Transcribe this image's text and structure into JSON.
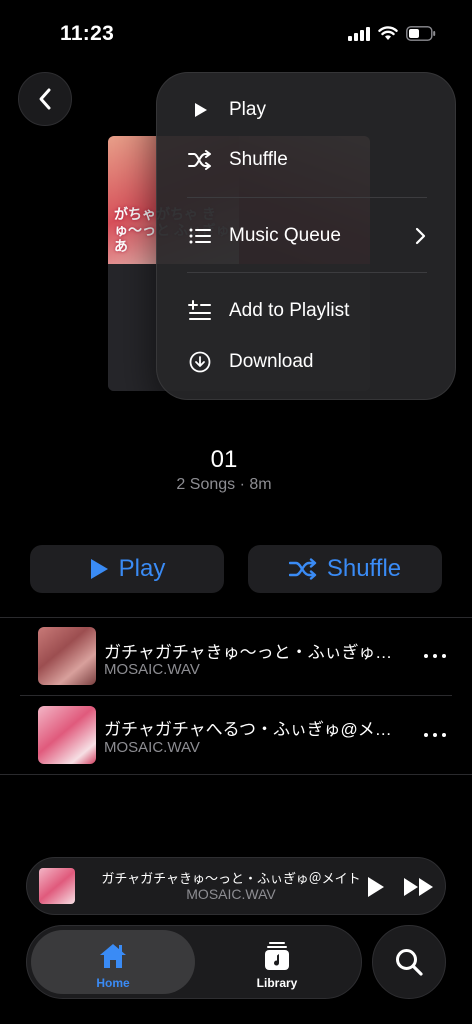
{
  "status_bar": {
    "time": "11:23"
  },
  "menu": {
    "items": [
      {
        "label": "Play",
        "icon": "play-icon"
      },
      {
        "label": "Shuffle",
        "icon": "shuffle-icon"
      },
      {
        "label": "Music Queue",
        "icon": "list-icon"
      },
      {
        "label": "Add to Playlist",
        "icon": "add-to-playlist-icon"
      },
      {
        "label": "Download",
        "icon": "download-icon"
      }
    ]
  },
  "album_art_text": "がちゃがちゃ きゅ〜っと ふぃぎゅあ",
  "playlist": {
    "title": "01",
    "meta": "2 Songs · 8m"
  },
  "actions": {
    "play_label": "Play",
    "shuffle_label": "Shuffle"
  },
  "songs": [
    {
      "title": "ガチャガチャきゅ〜っと・ふぃぎゅ@メイト",
      "artist": "MOSAIC.WAV"
    },
    {
      "title": "ガチャガチャへるつ・ふぃぎゅ@メイト",
      "artist": "MOSAIC.WAV"
    }
  ],
  "now_playing": {
    "title": "ガチャガチャきゅ〜っと・ふぃぎゅ＠メイト",
    "artist": "MOSAIC.WAV"
  },
  "tabs": {
    "home_label": "Home",
    "library_label": "Library"
  },
  "colors": {
    "accent": "#3a8bf5",
    "background": "#000000",
    "surface": "#1c1c1e"
  }
}
